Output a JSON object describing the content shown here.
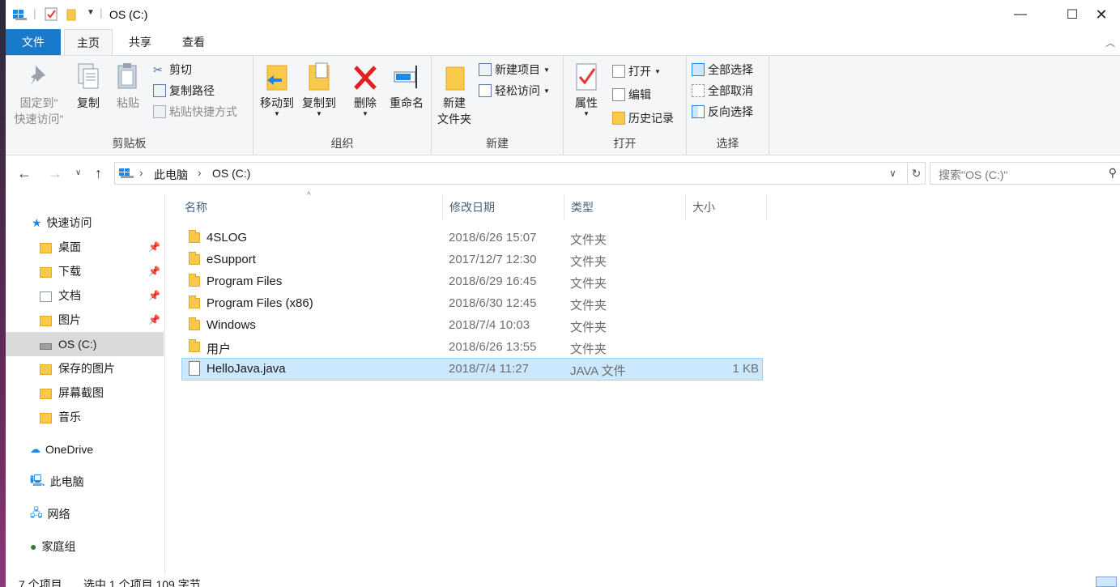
{
  "window": {
    "title": "OS (C:)",
    "minimize": "—",
    "maximize": "☐",
    "close": "✕"
  },
  "tabs": {
    "file": "文件",
    "home": "主页",
    "share": "共享",
    "view": "查看"
  },
  "ribbon": {
    "clipboard": {
      "label": "剪贴板",
      "pin_line1": "固定到\"",
      "pin_line2": "快速访问\"",
      "copy": "复制",
      "paste": "粘贴",
      "cut": "剪切",
      "copy_path": "复制路径",
      "paste_shortcut": "粘贴快捷方式"
    },
    "organize": {
      "label": "组织",
      "move_to": "移动到",
      "copy_to": "复制到",
      "delete": "删除",
      "rename": "重命名"
    },
    "new": {
      "label": "新建",
      "new_folder_line1": "新建",
      "new_folder_line2": "文件夹",
      "new_item": "新建项目",
      "easy_access": "轻松访问"
    },
    "open": {
      "label": "打开",
      "properties": "属性",
      "open": "打开",
      "edit": "编辑",
      "history": "历史记录"
    },
    "select": {
      "label": "选择",
      "select_all": "全部选择",
      "select_none": "全部取消",
      "invert": "反向选择"
    }
  },
  "address": {
    "crumb1": "此电脑",
    "crumb2": "OS (C:)",
    "search_placeholder": "搜索\"OS (C:)\""
  },
  "nav": {
    "quick_access": "快速访问",
    "desktop": "桌面",
    "downloads": "下载",
    "documents": "文档",
    "pictures": "图片",
    "os_c": "OS (C:)",
    "saved_pictures": "保存的图片",
    "screenshots": "屏幕截图",
    "music": "音乐",
    "onedrive": "OneDrive",
    "this_pc": "此电脑",
    "network": "网络",
    "homegroup": "家庭组"
  },
  "columns": {
    "name": "名称",
    "date": "修改日期",
    "type": "类型",
    "size": "大小"
  },
  "files": [
    {
      "name": "4SLOG",
      "date": "2018/6/26 15:07",
      "type": "文件夹",
      "size": ""
    },
    {
      "name": "eSupport",
      "date": "2017/12/7 12:30",
      "type": "文件夹",
      "size": ""
    },
    {
      "name": "Program Files",
      "date": "2018/6/29 16:45",
      "type": "文件夹",
      "size": ""
    },
    {
      "name": "Program Files (x86)",
      "date": "2018/6/30 12:45",
      "type": "文件夹",
      "size": ""
    },
    {
      "name": "Windows",
      "date": "2018/7/4 10:03",
      "type": "文件夹",
      "size": ""
    },
    {
      "name": "用户",
      "date": "2018/6/26 13:55",
      "type": "文件夹",
      "size": ""
    },
    {
      "name": "HelloJava.java",
      "date": "2018/7/4 11:27",
      "type": "JAVA 文件",
      "size": "1 KB"
    }
  ],
  "status": {
    "count": "7 个项目",
    "selected": "选中 1 个项目  109 字节"
  }
}
